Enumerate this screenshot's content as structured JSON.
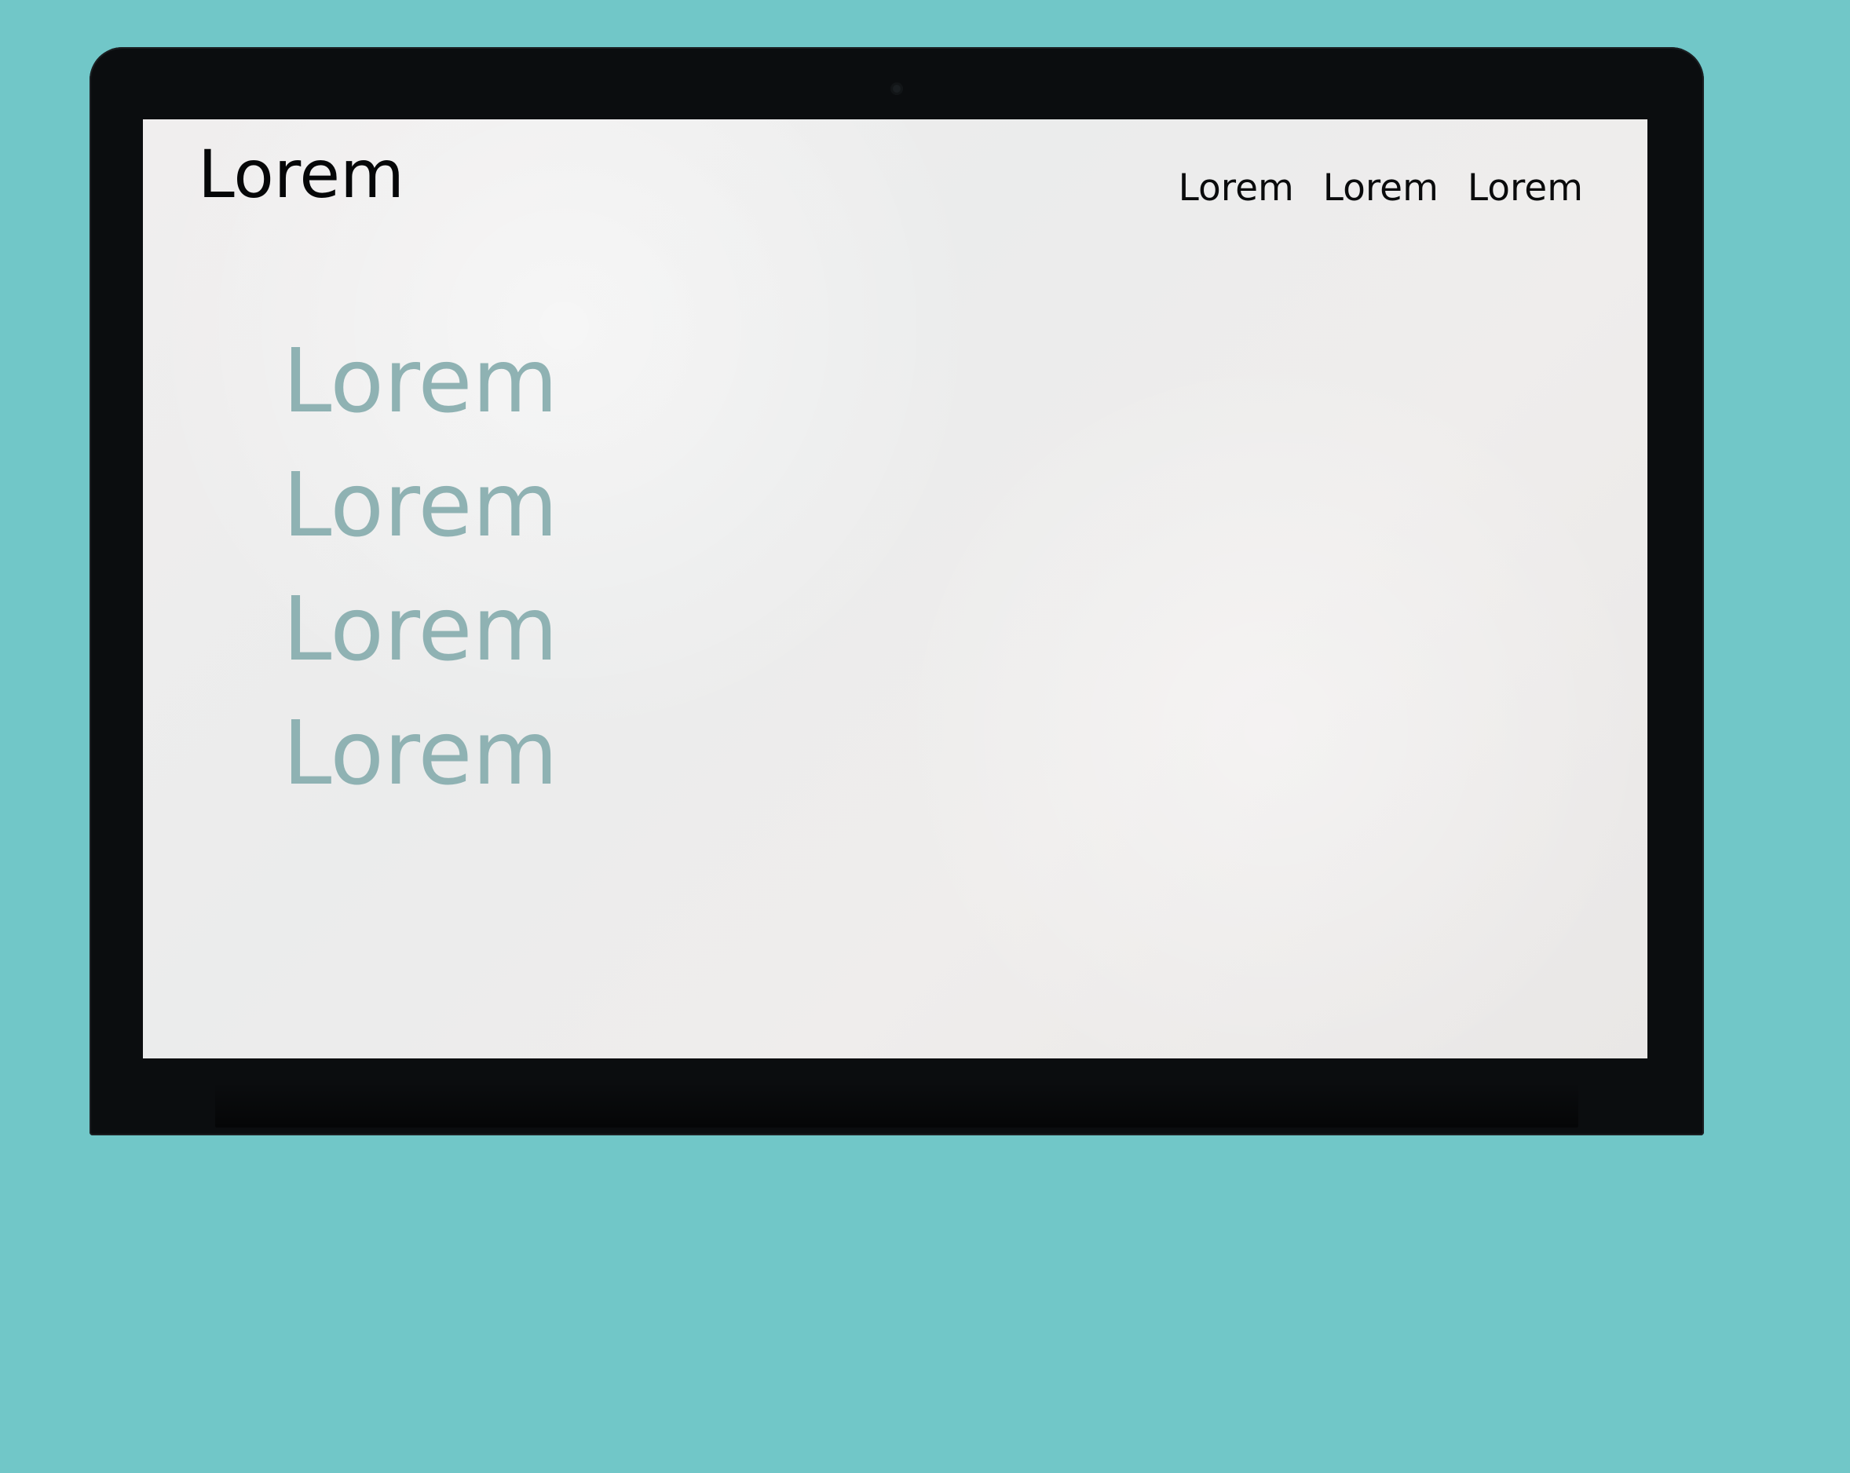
{
  "site": {
    "brand": "Lorem",
    "nav": [
      "Lorem",
      "Lorem",
      "Lorem"
    ],
    "menu": [
      "Lorem",
      "Lorem",
      "Lorem",
      "Lorem"
    ]
  },
  "colors": {
    "background": "#71c7c8",
    "frame": "#0b0d0f",
    "screen": "#efedec",
    "brand_text": "#060708",
    "menu_text": "#8fb2b3"
  }
}
